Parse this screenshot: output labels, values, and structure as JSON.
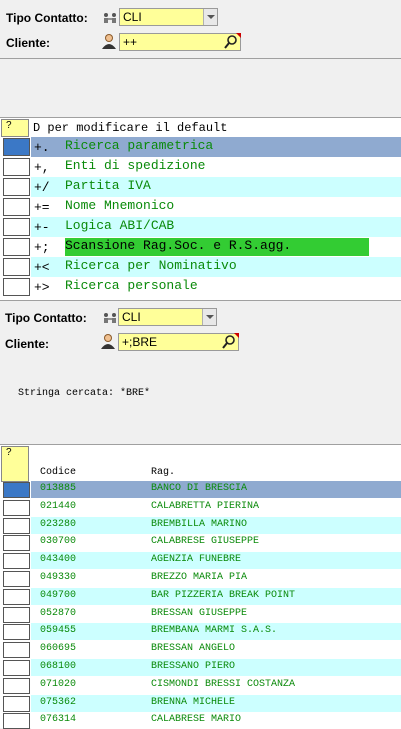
{
  "form1": {
    "tipo_contatto_label": "Tipo Contatto:",
    "tipo_contatto_value": "CLI",
    "cliente_label": "Cliente:",
    "cliente_value": "++"
  },
  "menu": {
    "header_question": "?",
    "header_text": "D per modificare il default",
    "items": [
      {
        "code": "+.",
        "label": "Ricerca parametrica"
      },
      {
        "code": "+,",
        "label": "Enti di spedizione"
      },
      {
        "code": "+/",
        "label": "Partita IVA"
      },
      {
        "code": "+=",
        "label": "Nome Mnemonico"
      },
      {
        "code": "+-",
        "label": "Logica ABI/CAB"
      },
      {
        "code": "+;",
        "label": "Scansione Rag.Soc. e R.S.agg."
      },
      {
        "code": "+<",
        "label": "Ricerca per Nominativo"
      },
      {
        "code": "+>",
        "label": "Ricerca personale"
      }
    ]
  },
  "form2": {
    "tipo_contatto_label": "Tipo Contatto:",
    "tipo_contatto_value": "CLI",
    "cliente_label": "Cliente:",
    "cliente_value": "+;BRE"
  },
  "search": {
    "text": "Stringa cercata: *BRE*"
  },
  "results": {
    "header_question": "?",
    "col_code": "Codice",
    "col_rag": "Rag.",
    "rows": [
      {
        "code": "013885",
        "name": "BANCO DI BRESCIA"
      },
      {
        "code": "021440",
        "name": "CALABRETTA PIERINA"
      },
      {
        "code": "023280",
        "name": "BREMBILLA MARINO"
      },
      {
        "code": "030700",
        "name": "CALABRESE GIUSEPPE"
      },
      {
        "code": "043400",
        "name": "AGENZIA FUNEBRE"
      },
      {
        "code": "049330",
        "name": "BREZZO MARIA PIA"
      },
      {
        "code": "049700",
        "name": "BAR PIZZERIA BREAK POINT"
      },
      {
        "code": "052870",
        "name": "BRESSAN GIUSEPPE"
      },
      {
        "code": "059455",
        "name": "BREMBANA MARMI S.A.S."
      },
      {
        "code": "060695",
        "name": "BRESSAN ANGELO"
      },
      {
        "code": "068100",
        "name": "BRESSANO PIERO"
      },
      {
        "code": "071020",
        "name": "CISMONDI BRESSI COSTANZA"
      },
      {
        "code": "075362",
        "name": "BRENNA MICHELE"
      },
      {
        "code": "076314",
        "name": "CALABRESE MARIO"
      }
    ]
  },
  "colors": {
    "highlight_blue": "#8faad0",
    "green_row": "#33cc33",
    "cyan_row": "#ccffff",
    "green_text": "#0a8a0a"
  }
}
